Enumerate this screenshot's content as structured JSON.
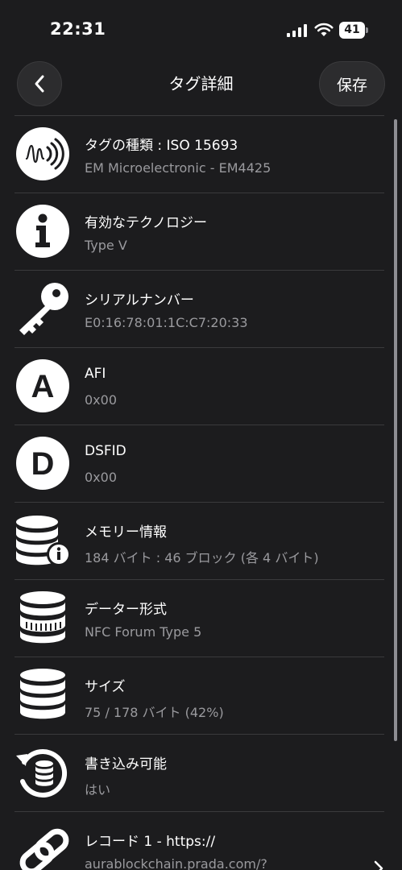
{
  "status_bar": {
    "time": "22:31",
    "battery": "41"
  },
  "nav": {
    "title": "タグ詳細",
    "save_label": "保存"
  },
  "items": [
    {
      "title": "タグの種類 : ISO 15693",
      "subtitle": "EM Microelectronic - EM4425",
      "icon": "nfc-tag-icon"
    },
    {
      "title": "有効なテクノロジー",
      "subtitle": "Type V",
      "icon": "info-icon"
    },
    {
      "title": "シリアルナンバー",
      "subtitle": "E0:16:78:01:1C:C7:20:33",
      "icon": "key-icon"
    },
    {
      "title": "AFI",
      "subtitle": "0x00",
      "icon": "letter-a-icon"
    },
    {
      "title": "DSFID",
      "subtitle": "0x00",
      "icon": "letter-d-icon"
    },
    {
      "title": "メモリー情報",
      "subtitle": "184 バイト : 46 ブロック (各 4 バイト)",
      "icon": "database-info-icon"
    },
    {
      "title": "データー形式",
      "subtitle": "NFC Forum Type 5",
      "icon": "database-icon"
    },
    {
      "title": "サイズ",
      "subtitle": "75 / 178 バイト (42%)",
      "icon": "database-stack-icon"
    },
    {
      "title": "書き込み可能",
      "subtitle": "はい",
      "icon": "database-refresh-icon"
    },
    {
      "title": "レコード 1 - https://",
      "subtitle": "aurablockchain.prada.com/?",
      "icon": "link-icon"
    }
  ],
  "colors": {
    "background": "#1c1c1e",
    "divider": "#3a3a3c",
    "subtitle": "#9a9a9e",
    "button_bg": "#2c2c2e"
  }
}
